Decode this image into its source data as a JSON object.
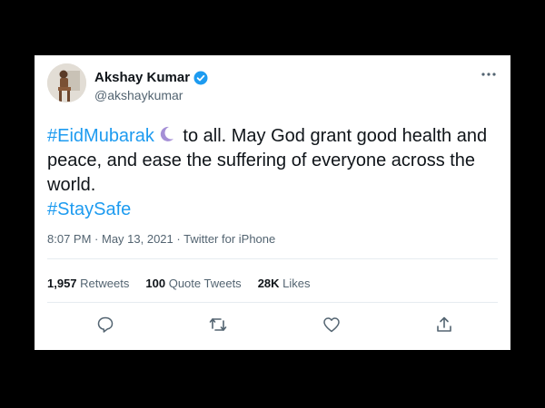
{
  "author": {
    "name": "Akshay Kumar",
    "handle": "@akshaykumar"
  },
  "tweet": {
    "hashtag1": "#EidMubarak",
    "emoji": "crescent-moon-icon",
    "line1_rest": " to all. May God grant good health and",
    "line2": "peace, and ease the suffering of everyone across the",
    "line3": "world.",
    "hashtag2": "#StaySafe"
  },
  "meta": {
    "time": "8:07 PM",
    "date": "May 13, 2021",
    "source": "Twitter for iPhone",
    "sep": " · "
  },
  "stats": {
    "retweets_count": "1,957",
    "retweets_label": "Retweets",
    "quotes_count": "100",
    "quotes_label": "Quote Tweets",
    "likes_count": "28K",
    "likes_label": "Likes"
  },
  "icons": {
    "reply": "reply-icon",
    "retweet": "retweet-icon",
    "like": "heart-icon",
    "share": "share-icon",
    "more": "more-icon",
    "verified": "verified-badge-icon"
  },
  "colors": {
    "link": "#1d9bf0",
    "text": "#0f1419",
    "muted": "#536471",
    "background": "#000000"
  }
}
